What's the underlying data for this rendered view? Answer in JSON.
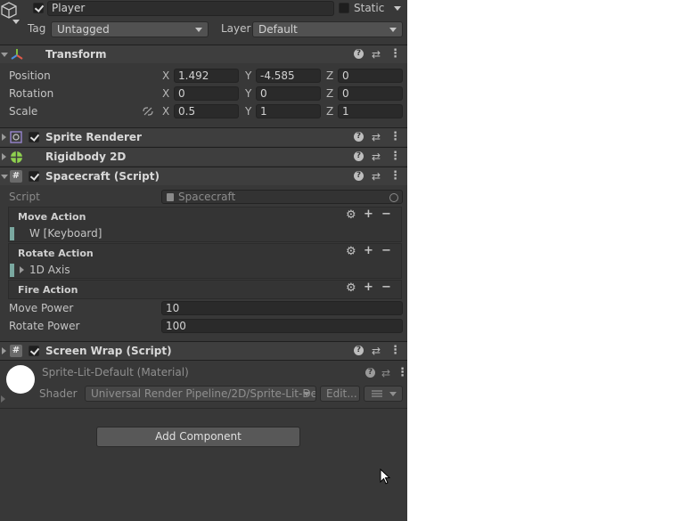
{
  "gameobject": {
    "name": "Player",
    "active_checked": true,
    "static_label": "Static",
    "static_checked": false,
    "tag_label": "Tag",
    "tag_value": "Untagged",
    "layer_label": "Layer",
    "layer_value": "Default"
  },
  "transform": {
    "title": "Transform",
    "position_label": "Position",
    "rotation_label": "Rotation",
    "scale_label": "Scale",
    "axis_x": "X",
    "axis_y": "Y",
    "axis_z": "Z",
    "position": {
      "x": "1.492",
      "y": "-4.585",
      "z": "0"
    },
    "rotation": {
      "x": "0",
      "y": "0",
      "z": "0"
    },
    "scale": {
      "x": "0.5",
      "y": "1",
      "z": "1"
    }
  },
  "components": {
    "sprite_renderer": "Sprite Renderer",
    "rigidbody": "Rigidbody 2D",
    "spacecraft": "Spacecraft (Script)",
    "screen_wrap": "Screen Wrap (Script)"
  },
  "spacecraft": {
    "script_label": "Script",
    "script_value": "Spacecraft",
    "move_action_title": "Move Action",
    "move_binding": "W [Keyboard]",
    "rotate_action_title": "Rotate Action",
    "rotate_binding": "1D Axis",
    "fire_action_title": "Fire Action",
    "move_power_label": "Move Power",
    "move_power_value": "10",
    "rotate_power_label": "Rotate Power",
    "rotate_power_value": "100"
  },
  "material": {
    "title": "Sprite-Lit-Default (Material)",
    "shader_label": "Shader",
    "shader_value": "Universal Render Pipeline/2D/Sprite-Lit-Def",
    "edit_label": "Edit...",
    "list_icon": "list-icon"
  },
  "add_component_label": "Add Component",
  "icons": {
    "help": "?",
    "slider": "⇄",
    "kebab": "⋮",
    "plus": "+",
    "minus": "−",
    "gear": "⚙"
  },
  "colors": {
    "panel": "#383838",
    "field": "#2a2a2a",
    "accent_binding": "#7aa8a0"
  }
}
